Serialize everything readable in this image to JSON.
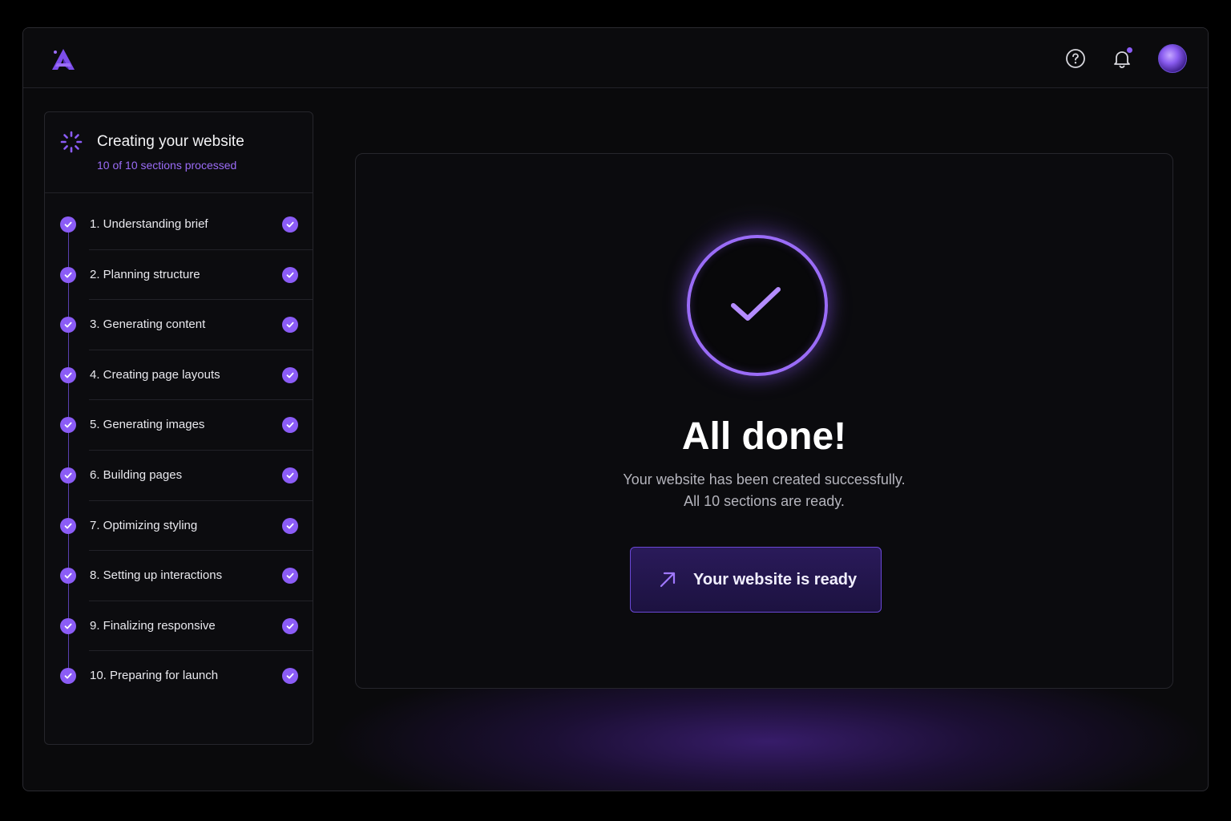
{
  "header": {
    "logo_icon": "a-logo-icon",
    "help_icon": "help-circle-icon",
    "bell_icon": "bell-icon",
    "avatar_icon": "avatar"
  },
  "sidebar": {
    "title": "Creating your website",
    "subtitle": "10 of 10 sections processed",
    "progress": {
      "done": 10,
      "total": 10
    },
    "steps": [
      {
        "label": "1. Understanding brief",
        "status": "complete"
      },
      {
        "label": "2. Planning structure",
        "status": "complete"
      },
      {
        "label": "3. Generating content",
        "status": "complete"
      },
      {
        "label": "4. Creating page layouts",
        "status": "complete"
      },
      {
        "label": "5. Generating images",
        "status": "complete"
      },
      {
        "label": "6. Building pages",
        "status": "complete"
      },
      {
        "label": "7. Optimizing styling",
        "status": "complete"
      },
      {
        "label": "8. Setting up interactions",
        "status": "complete"
      },
      {
        "label": "9. Finalizing responsive",
        "status": "complete"
      },
      {
        "label": "10. Preparing for launch",
        "status": "complete"
      }
    ]
  },
  "main": {
    "title": "All done!",
    "line1": "Your website has been created successfully.",
    "line2": "All 10 sections are ready.",
    "button_label": "Your website is ready"
  },
  "colors": {
    "accent": "#8b5cf6",
    "accent_light": "#9b6cf7",
    "background": "#0a0a0c"
  }
}
